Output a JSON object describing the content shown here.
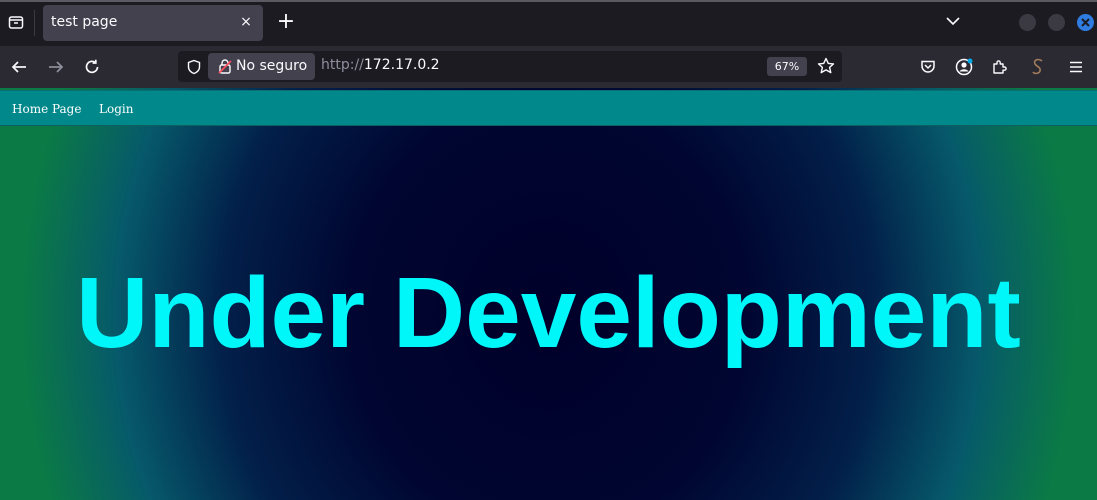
{
  "browser": {
    "tab": {
      "title": "test page",
      "close_label": "×"
    },
    "new_tab_label": "+",
    "security_label": "No seguro",
    "url": {
      "scheme": "http://",
      "host": "172.17.0.2"
    },
    "zoom": "67%"
  },
  "page": {
    "nav": [
      {
        "label": "Home Page"
      },
      {
        "label": "Login"
      }
    ],
    "hero": "Under Development"
  },
  "colors": {
    "nav_bar": "#00888a",
    "hero_text": "#00f7fa",
    "window_close": "#2f7de1"
  }
}
